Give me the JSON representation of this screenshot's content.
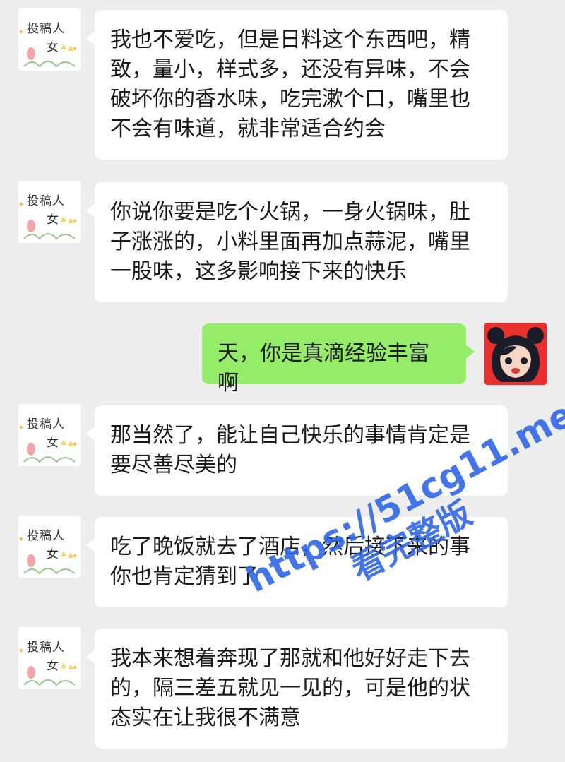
{
  "contact": {
    "avatar_line1": "投稿人",
    "avatar_line2": "女"
  },
  "messages": [
    {
      "side": "left",
      "text": "我也不爱吃，但是日料这个东西吧，精致，量小，样式多，还没有异味，不会破坏你的香水味，吃完漱个口，嘴里也不会有味道，就非常适合约会"
    },
    {
      "side": "left",
      "text": "你说你要是吃个火锅，一身火锅味，肚子涨涨的，小料里面再加点蒜泥，嘴里一股味，这多影响接下来的快乐"
    },
    {
      "side": "right",
      "text": "天，你是真滴经验丰富啊"
    },
    {
      "side": "left",
      "text": "那当然了，能让自己快乐的事情肯定是要尽善尽美的"
    },
    {
      "side": "left",
      "text": "吃了晚饭就去了酒店，然后接下来的事你也肯定猜到了"
    },
    {
      "side": "left",
      "text": "我本来想着奔现了那就和他好好走下去的，隔三差五就见一见的，可是他的状态实在让我很不满意"
    }
  ],
  "watermark": {
    "line1": "https://51cg11.me",
    "line2": "看完整版"
  },
  "colors": {
    "background": "#ededed",
    "incoming_bubble": "#ffffff",
    "outgoing_bubble": "#95ec69",
    "watermark": "#2f67e6"
  }
}
